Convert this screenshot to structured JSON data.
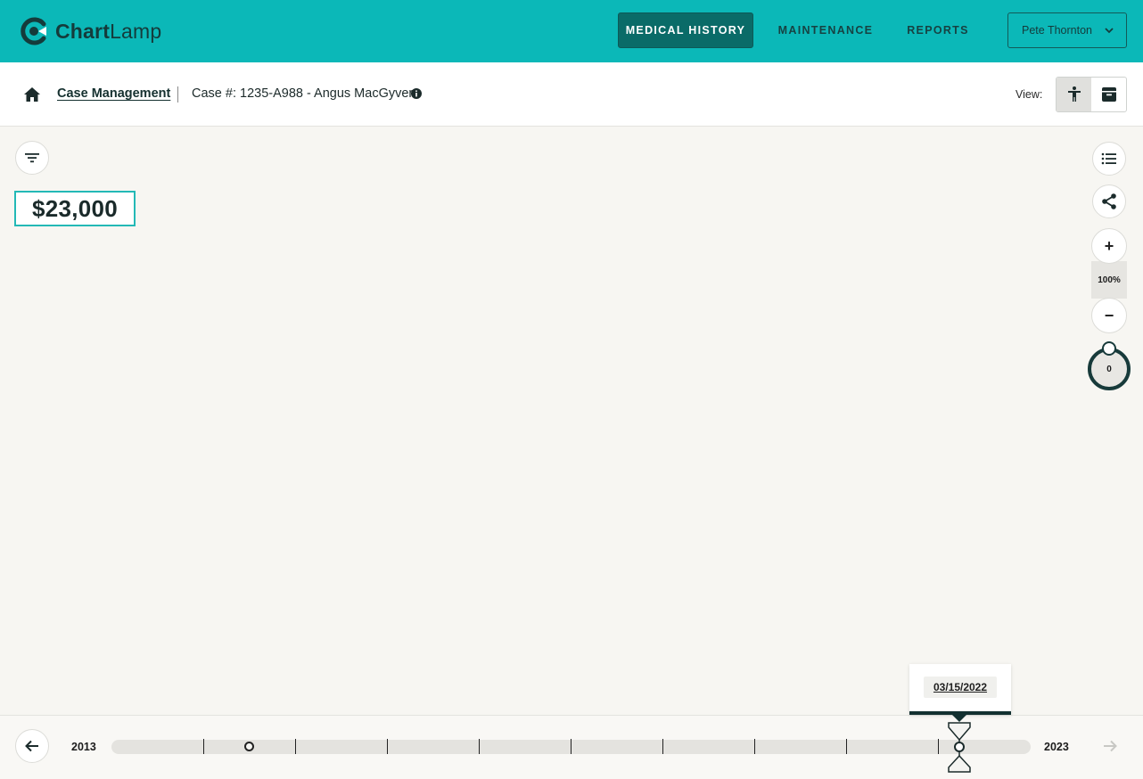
{
  "header": {
    "brand_bold": "Chart",
    "brand_light": "Lamp",
    "nav": [
      {
        "label": "MEDICAL HISTORY",
        "active": true
      },
      {
        "label": "MAINTENANCE",
        "active": false
      },
      {
        "label": "REPORTS",
        "active": false
      }
    ],
    "user": "Pete Thornton"
  },
  "breadcrumb": {
    "link": "Case Management",
    "case": "Case #: 1235-A988 - Angus MacGyver",
    "view_label": "View:"
  },
  "canvas": {
    "total": "$23,000",
    "zoom_level": "100%",
    "zoom_in": "+",
    "zoom_out": "−",
    "dial_value": "0"
  },
  "timeline": {
    "start_year": "2013",
    "end_year": "2023",
    "selected_date": "03/15/2022"
  },
  "colors": {
    "brand_teal": "#0bb8b8",
    "nav_active": "#0a6b68",
    "dark": "#153b3b",
    "accent_border": "#23b9b6"
  },
  "icons": [
    "home-icon",
    "info-icon",
    "accessibility-icon",
    "archive-icon",
    "filter-icon",
    "list-icon",
    "share-icon",
    "arrow-left-icon",
    "arrow-right-icon",
    "chevron-down-icon",
    "hourglass-icon"
  ]
}
